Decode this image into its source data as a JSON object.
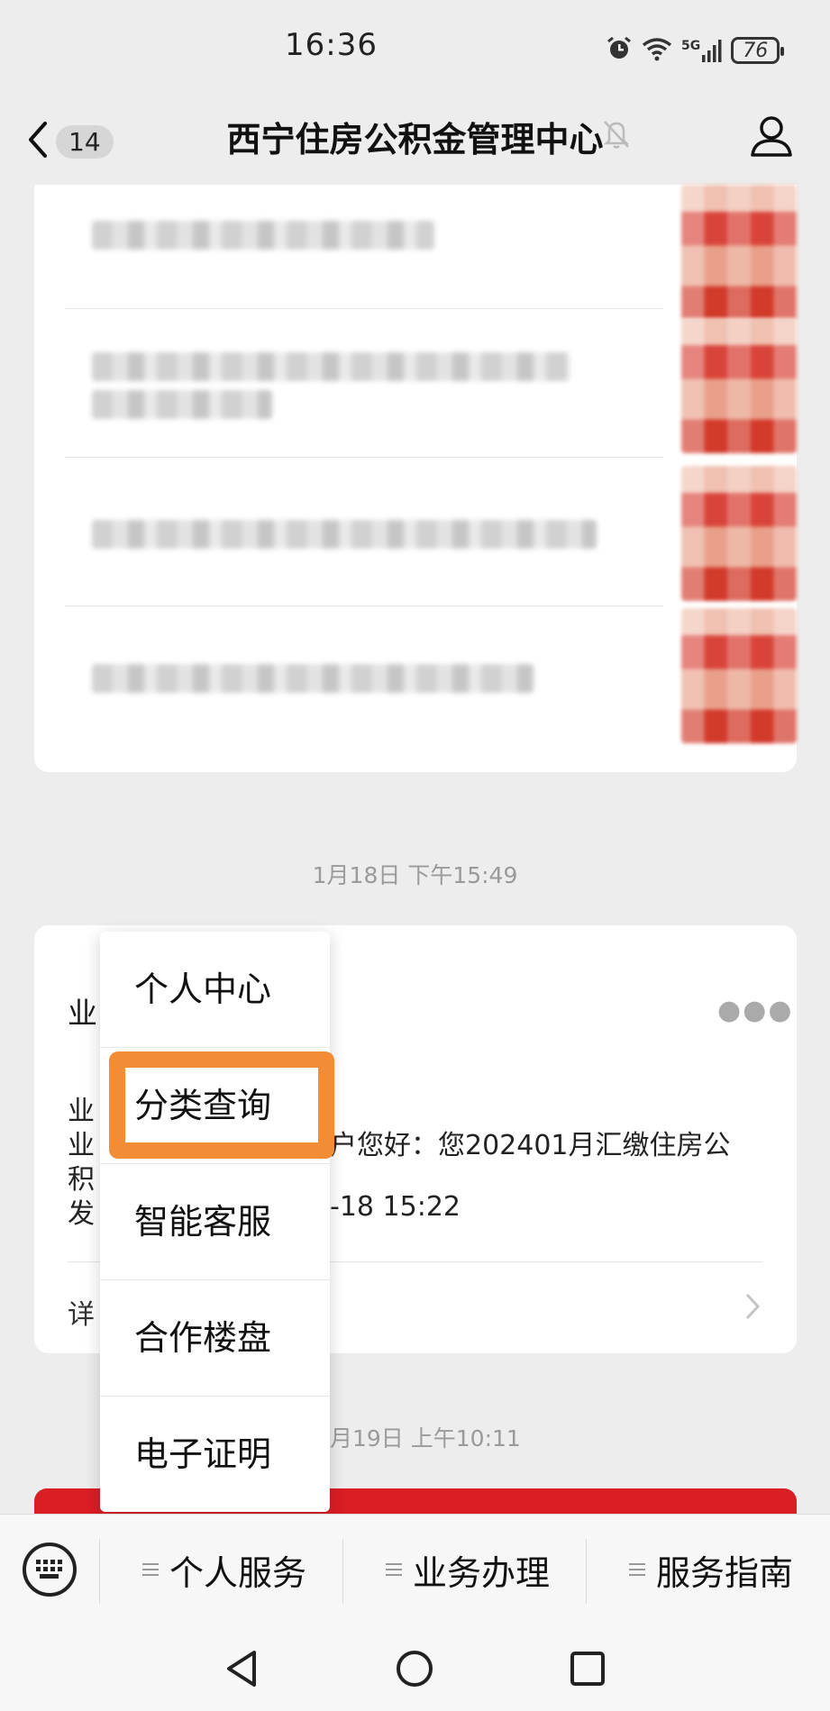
{
  "status_bar": {
    "time": "16:36",
    "network": "5G",
    "battery": "76"
  },
  "header": {
    "unread_count": "14",
    "title": "西宁住房公积金管理中心"
  },
  "card2_timestamp": "1月18日 下午15:49",
  "card2": {
    "title_fragment": "业",
    "body_line1_fragment": "业",
    "body_line2_fragment": "业",
    "body_line2_visible": "户您好：您202401月汇缴住房公",
    "body_line3_fragment": "积",
    "body_line4_fragment": "发",
    "body_line4_visible": "-18 15:22",
    "details_fragment": "详"
  },
  "next_timestamp_visible": "月19日 上午10:11",
  "popup_menu": {
    "items": [
      "个人中心",
      "分类查询",
      "智能客服",
      "合作楼盘",
      "电子证明"
    ],
    "highlighted_item": "分类查询",
    "highlight_color": "#f28c35"
  },
  "bottom_menu": {
    "items": [
      "个人服务",
      "业务办理",
      "服务指南"
    ]
  },
  "colors": {
    "background": "#ededed",
    "card": "#ffffff",
    "banner_red": "#d91e24"
  }
}
